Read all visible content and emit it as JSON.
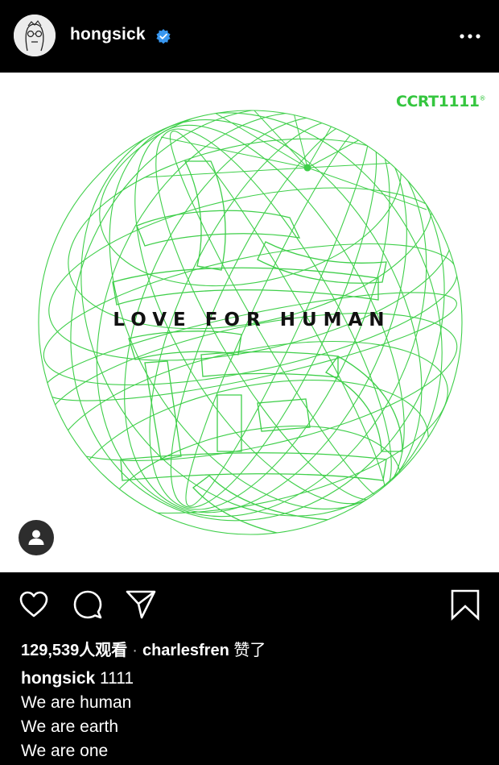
{
  "header": {
    "username": "hongsick",
    "avatar_icon": "avatar-sketch-icon",
    "verified_icon": "verified-badge-icon",
    "more_icon": "more-options-icon"
  },
  "post": {
    "brand_label": "CCRT",
    "brand_number": "1111",
    "brand_mark": "®",
    "slogan": "LOVE FOR HUMAN",
    "accent_color": "#35c63f",
    "tag_icon": "user-tag-icon"
  },
  "actions": {
    "like_icon": "heart-icon",
    "comment_icon": "comment-icon",
    "share_icon": "send-icon",
    "save_icon": "bookmark-icon"
  },
  "likes": {
    "count": "129,539",
    "count_suffix": "人观看",
    "separator": "·",
    "liked_by": "charlesfren",
    "liked_suffix": "赞了"
  },
  "caption": {
    "username": "hongsick",
    "title": "1111",
    "lines": [
      "We are human",
      "We are earth",
      "We are one"
    ]
  }
}
